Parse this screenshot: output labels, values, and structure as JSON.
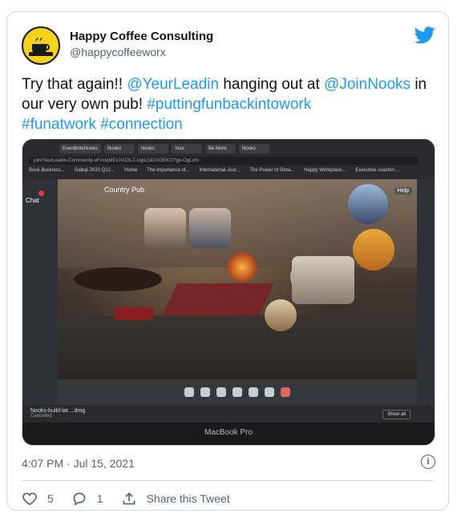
{
  "author": {
    "name": "Happy Coffee Consulting",
    "handle": "@happycoffeeworx",
    "avatar_text": "HAPPY COFFEE CONSULTING"
  },
  "icons": {
    "brand": "twitter-bird-icon",
    "info": "info-icon",
    "like": "heart-icon",
    "reply": "reply-icon",
    "share": "share-icon"
  },
  "tweet": {
    "p1": "Try that again!! ",
    "mention1": "@YeurLeadin",
    "p2": " hanging out at ",
    "mention2": "@JoinNooks",
    "p3": " in our very own pub! ",
    "tag1": "#puttingfunbackintowork",
    "tag2": "#funatwork",
    "tag3": "#connection"
  },
  "screenshot": {
    "tabs": [
      "EventbriteNooks",
      "Nooks",
      "Nooks",
      "Your",
      "Be More",
      "Nooks"
    ],
    "url": "join/YeurLeadin-Community-uFvcIqMEx7kIDtLZ-UgiLGIOXOEKCt?gv-OgLxiV...",
    "bookmarks": [
      "Book Business...",
      "Gallup 2020 Q12...",
      "Home",
      "The importance of...",
      "International Jour...",
      "The Power of Grea...",
      "Happy Workplace...",
      "Executive coachin..."
    ],
    "room_title": "Country Pub",
    "chat_label": "Chat",
    "help_label": "Help",
    "download_file": "Nooks-build-lat....dmg",
    "download_status": "Cancelled",
    "show_all": "Show all",
    "device_label": "MacBook Pro"
  },
  "footer": {
    "timestamp": "4:07 PM · Jul 15, 2021",
    "likes": "5",
    "replies": "1",
    "share_label": "Share this Tweet"
  },
  "colors": {
    "link": "#1d9bf0",
    "muted": "#536471",
    "avatar_bg": "#f6d21a"
  }
}
